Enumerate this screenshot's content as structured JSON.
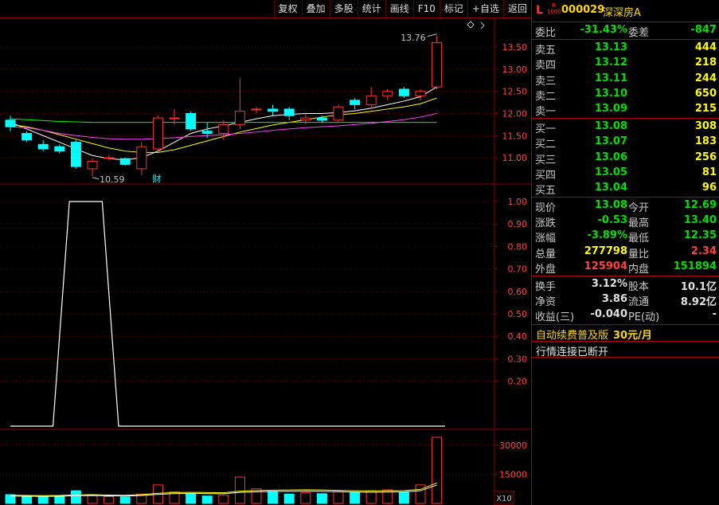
{
  "toolbar": {
    "buttons": [
      "复权",
      "叠加",
      "多股",
      "统计",
      "画线",
      "F10",
      "标记",
      "+自选",
      "返回"
    ]
  },
  "stock": {
    "logo": "L",
    "sub_top": "R",
    "sub_bottom": "1000",
    "code": "000029",
    "name": "深深房A"
  },
  "order_book": {
    "weibi": {
      "label": "委比",
      "value": "-31.43%",
      "label2": "委差",
      "value2": "-847"
    },
    "asks": [
      {
        "label": "卖五",
        "price": "13.13",
        "volume": "444"
      },
      {
        "label": "卖四",
        "price": "13.12",
        "volume": "218"
      },
      {
        "label": "卖三",
        "price": "13.11",
        "volume": "244"
      },
      {
        "label": "卖二",
        "price": "13.10",
        "volume": "650"
      },
      {
        "label": "卖一",
        "price": "13.09",
        "volume": "215"
      }
    ],
    "bids": [
      {
        "label": "买一",
        "price": "13.08",
        "volume": "308"
      },
      {
        "label": "买二",
        "price": "13.07",
        "volume": "183"
      },
      {
        "label": "买三",
        "price": "13.06",
        "volume": "256"
      },
      {
        "label": "买四",
        "price": "13.05",
        "volume": "81"
      },
      {
        "label": "买五",
        "price": "13.04",
        "volume": "96"
      }
    ]
  },
  "quote": [
    {
      "l1": "现价",
      "v1": "13.08",
      "c1": "g",
      "l2": "今开",
      "v2": "12.69",
      "c2": "g"
    },
    {
      "l1": "涨跌",
      "v1": "-0.53",
      "c1": "g",
      "l2": "最高",
      "v2": "13.40",
      "c2": "g"
    },
    {
      "l1": "涨幅",
      "v1": "-3.89%",
      "c1": "g",
      "l2": "最低",
      "v2": "12.35",
      "c2": "g"
    },
    {
      "l1": "总量",
      "v1": "277798",
      "c1": "y",
      "l2": "量比",
      "v2": "2.34",
      "c2": "r"
    },
    {
      "l1": "外盘",
      "v1": "125904",
      "c1": "r",
      "l2": "内盘",
      "v2": "151894",
      "c2": "g"
    }
  ],
  "fundamentals": [
    {
      "l1": "换手",
      "v1": "3.12%",
      "l2": "股本",
      "v2": "10.1亿"
    },
    {
      "l1": "净资",
      "v1": "3.86",
      "l2": "流通",
      "v2": "8.92亿"
    },
    {
      "l1": "收益(三)",
      "v1": "-0.040",
      "l2": "PE(动)",
      "v2": "-"
    }
  ],
  "promo": {
    "text": "自动续费普及版",
    "price": "30元/月"
  },
  "status": "行情连接已断开",
  "colors": {
    "up": "#ff3030",
    "down": "#00ffff",
    "grid": "#8b0000",
    "ma5": "#ffffff",
    "ma10": "#ffff00",
    "ma20": "#ff40ff",
    "ma60": "#00ff00"
  },
  "chart_data": [
    {
      "type": "candlestick",
      "y_axis": [
        13.5,
        13.0,
        12.5,
        12.0,
        11.5,
        11.0
      ],
      "ylim": [
        10.55,
        13.9
      ],
      "annotations": {
        "high_label": "13.76",
        "low_label": "10.59",
        "event_label": "财"
      },
      "candles": [
        {
          "o": 11.85,
          "h": 11.95,
          "l": 11.6,
          "c": 11.7
        },
        {
          "o": 11.55,
          "h": 11.6,
          "l": 11.35,
          "c": 11.4
        },
        {
          "o": 11.3,
          "h": 11.4,
          "l": 11.15,
          "c": 11.2
        },
        {
          "o": 11.25,
          "h": 11.3,
          "l": 11.1,
          "c": 11.15
        },
        {
          "o": 11.35,
          "h": 11.4,
          "l": 10.75,
          "c": 10.8
        },
        {
          "o": 10.75,
          "h": 10.98,
          "l": 10.59,
          "c": 10.92
        },
        {
          "o": 11.0,
          "h": 11.05,
          "l": 10.95,
          "c": 11.0
        },
        {
          "o": 10.98,
          "h": 11.0,
          "l": 10.82,
          "c": 10.85
        },
        {
          "o": 10.75,
          "h": 11.35,
          "l": 10.6,
          "c": 11.25
        },
        {
          "o": 11.2,
          "h": 11.95,
          "l": 11.15,
          "c": 11.9
        },
        {
          "o": 11.9,
          "h": 12.1,
          "l": 11.75,
          "c": 11.9
        },
        {
          "o": 12.0,
          "h": 12.05,
          "l": 11.6,
          "c": 11.65
        },
        {
          "o": 11.6,
          "h": 11.8,
          "l": 11.45,
          "c": 11.55
        },
        {
          "o": 11.55,
          "h": 11.85,
          "l": 11.4,
          "c": 11.75
        },
        {
          "o": 11.75,
          "h": 12.8,
          "l": 11.65,
          "c": 12.05
        },
        {
          "o": 12.1,
          "h": 12.15,
          "l": 12.0,
          "c": 12.1
        },
        {
          "o": 12.1,
          "h": 12.2,
          "l": 11.95,
          "c": 12.05
        },
        {
          "o": 12.1,
          "h": 12.15,
          "l": 11.85,
          "c": 11.95
        },
        {
          "o": 11.85,
          "h": 12.0,
          "l": 11.75,
          "c": 11.9
        },
        {
          "o": 11.9,
          "h": 11.95,
          "l": 11.8,
          "c": 11.85
        },
        {
          "o": 11.85,
          "h": 12.2,
          "l": 11.8,
          "c": 12.15
        },
        {
          "o": 12.3,
          "h": 12.35,
          "l": 12.1,
          "c": 12.2
        },
        {
          "o": 12.2,
          "h": 12.6,
          "l": 12.1,
          "c": 12.4
        },
        {
          "o": 12.4,
          "h": 12.55,
          "l": 12.3,
          "c": 12.5
        },
        {
          "o": 12.55,
          "h": 12.6,
          "l": 12.35,
          "c": 12.4
        },
        {
          "o": 12.4,
          "h": 12.55,
          "l": 12.3,
          "c": 12.5
        },
        {
          "o": 12.6,
          "h": 13.76,
          "l": 12.55,
          "c": 13.6
        }
      ],
      "ma": [
        {
          "color": "#ffffff",
          "values": [
            11.8,
            11.65,
            11.5,
            11.35,
            11.2,
            11.05,
            10.98,
            10.95,
            11.0,
            11.15,
            11.35,
            11.55,
            11.65,
            11.72,
            11.8,
            11.88,
            11.95,
            11.98,
            12.0,
            12.0,
            12.02,
            12.06,
            12.12,
            12.2,
            12.28,
            12.38,
            12.6
          ]
        },
        {
          "color": "#ffff00",
          "values": [
            11.75,
            11.7,
            11.62,
            11.52,
            11.42,
            11.32,
            11.22,
            11.15,
            11.12,
            11.12,
            11.18,
            11.28,
            11.38,
            11.48,
            11.58,
            11.66,
            11.74,
            11.8,
            11.86,
            11.92,
            11.97,
            12.0,
            12.05,
            12.1,
            12.15,
            12.22,
            12.35
          ]
        },
        {
          "color": "#ff40ff",
          "values": [
            11.7,
            11.68,
            11.62,
            11.55,
            11.5,
            11.46,
            11.43,
            11.42,
            11.42,
            11.43,
            11.45,
            11.48,
            11.5,
            11.52,
            11.55,
            11.58,
            11.62,
            11.65,
            11.68,
            11.7,
            11.72,
            11.75,
            11.78,
            11.82,
            11.86,
            11.92,
            12.0
          ]
        },
        {
          "color": "#00ff00",
          "values": [
            11.88,
            11.86,
            11.84,
            11.82,
            11.81,
            11.8,
            11.8,
            11.8,
            11.8,
            11.8,
            11.8,
            11.8,
            11.8,
            11.8,
            11.8,
            11.8,
            11.8,
            11.8,
            11.8,
            11.8,
            11.8,
            11.8,
            11.8,
            11.8,
            11.8,
            11.8,
            11.8
          ]
        }
      ]
    },
    {
      "type": "line",
      "y_axis": [
        1.0,
        0.9,
        0.8,
        0.7,
        0.6,
        0.5,
        0.4,
        0.3,
        0.2
      ],
      "ylim": [
        0,
        1.0
      ],
      "x": [
        0,
        2.6,
        3.6,
        5.6,
        6.6,
        26.5
      ],
      "values": [
        0,
        0,
        1,
        1,
        0,
        0
      ]
    },
    {
      "type": "bar",
      "y_axis": [
        30000,
        15000
      ],
      "ylim": [
        0,
        34000
      ],
      "badge": "X10",
      "values": [
        4500,
        3800,
        3500,
        4000,
        6500,
        4200,
        3500,
        3300,
        4800,
        9500,
        6000,
        5000,
        3800,
        4200,
        13500,
        7500,
        6200,
        4800,
        5500,
        5000,
        6000,
        5500,
        6500,
        7000,
        5800,
        9500,
        34000
      ],
      "ma_values": [
        4200,
        4100,
        4000,
        4100,
        4400,
        4500,
        4300,
        4200,
        4500,
        5200,
        5600,
        5700,
        5600,
        5500,
        6300,
        6600,
        6800,
        6900,
        7000,
        6900,
        6700,
        6500,
        6400,
        6500,
        6600,
        7200,
        10500
      ]
    }
  ]
}
